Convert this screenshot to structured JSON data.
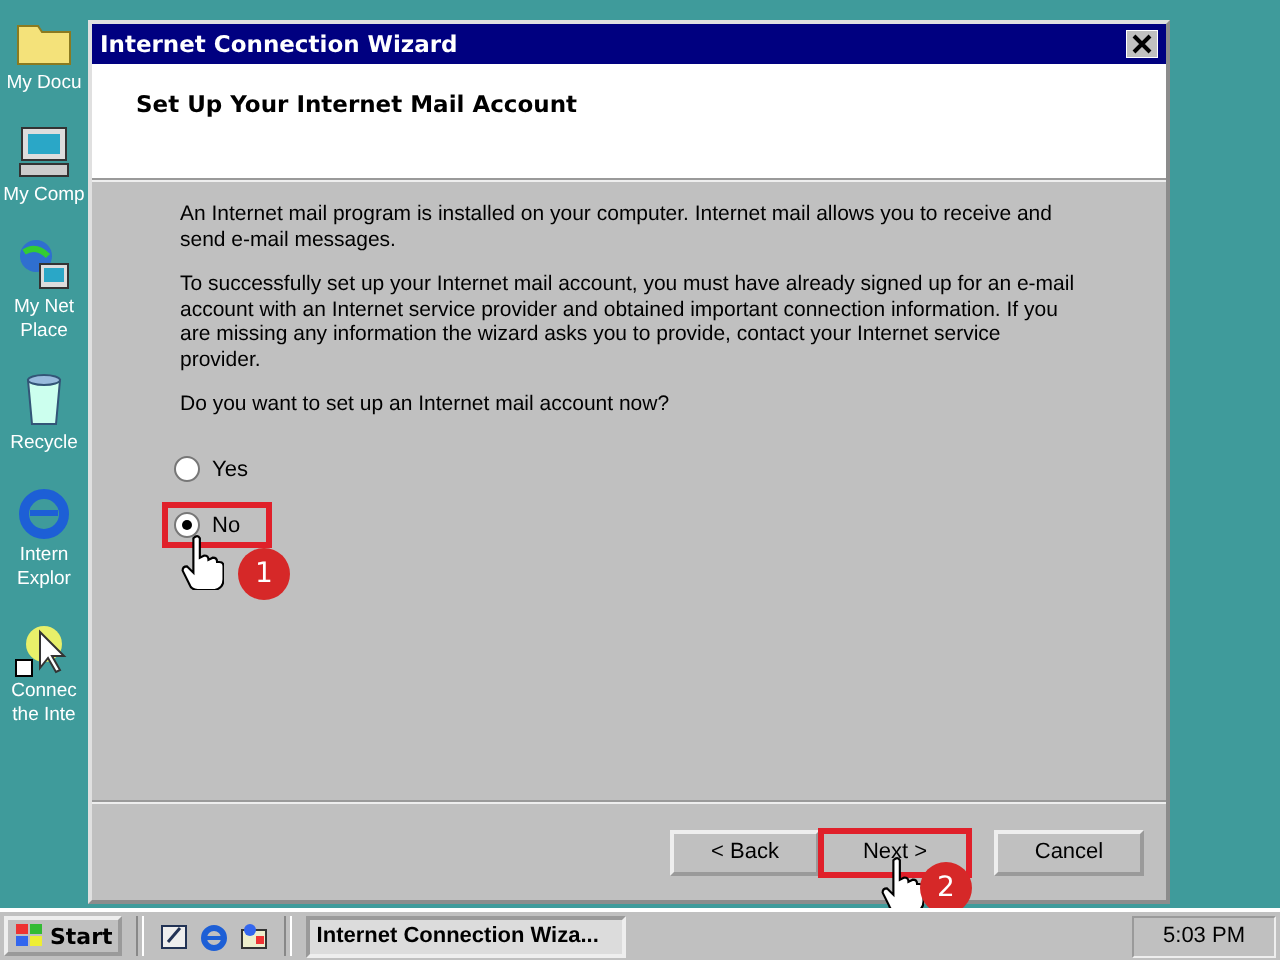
{
  "desktop_icons": [
    {
      "kind": "folder",
      "label": [
        "My Docu"
      ]
    },
    {
      "kind": "computer",
      "label": [
        "My Comp"
      ]
    },
    {
      "kind": "network",
      "label": [
        "My Net",
        "Place"
      ]
    },
    {
      "kind": "recycle",
      "label": [
        "Recycle"
      ]
    },
    {
      "kind": "ie",
      "label": [
        "Intern",
        "Explor"
      ]
    },
    {
      "kind": "connect",
      "label": [
        "Connec",
        "the Inte"
      ]
    }
  ],
  "window": {
    "title": "Internet Connection Wizard",
    "heading": "Set Up Your Internet Mail Account",
    "paragraphs": [
      "An Internet mail program is installed on your computer. Internet mail allows you to receive and send e-mail messages.",
      "To successfully set up your Internet mail account, you must have already signed up for an e-mail account with an Internet service provider and obtained important connection information. If you are missing any information the wizard asks you to provide, contact your Internet service provider."
    ],
    "question": "Do you want to set up an Internet mail account now?",
    "options": [
      {
        "label": "Yes",
        "selected": false
      },
      {
        "label": "No",
        "selected": true,
        "step": "1"
      }
    ],
    "buttons": [
      {
        "label": "< Back"
      },
      {
        "label": "Next >",
        "step": "2"
      },
      {
        "label": "Cancel"
      }
    ]
  },
  "taskbar": {
    "start": "Start",
    "quick_launch": [
      {
        "kind": "desktop"
      },
      {
        "kind": "ie"
      },
      {
        "kind": "channels"
      }
    ],
    "task": "Internet Connection Wiza...",
    "clock": "5:03 PM"
  }
}
